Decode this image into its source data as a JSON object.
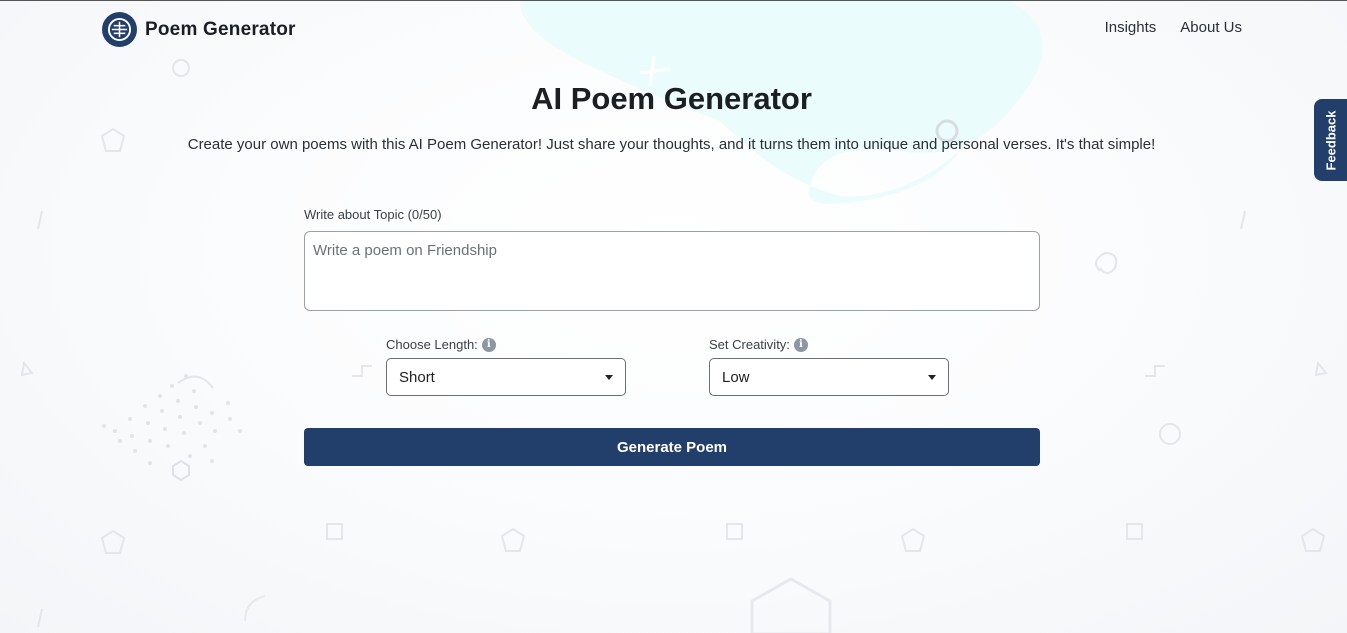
{
  "header": {
    "brand_name": "Poem Generator",
    "logo_icon": "brain-chip-icon",
    "nav": [
      {
        "label": "Insights"
      },
      {
        "label": "About Us"
      }
    ]
  },
  "feedback_tab": {
    "label": "Feedback"
  },
  "main": {
    "title": "AI Poem Generator",
    "subtitle": "Create your own poems with this AI Poem Generator! Just share your thoughts, and it turns them into unique and personal verses. It's that simple!",
    "topic": {
      "label": "Write about Topic (0/50)",
      "placeholder": "Write a poem on Friendship",
      "value": ""
    },
    "length": {
      "label": "Choose Length:",
      "selected": "Short",
      "info_icon": "info-icon"
    },
    "creativity": {
      "label": "Set Creativity:",
      "selected": "Low",
      "info_icon": "info-icon"
    },
    "generate_button": "Generate Poem"
  },
  "colors": {
    "primary": "#223f6b",
    "accent_blob": "#e6fbfb",
    "text": "#1b1f24"
  }
}
